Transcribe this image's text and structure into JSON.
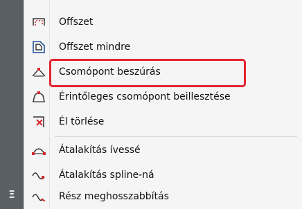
{
  "menu": {
    "items": [
      {
        "label": "Offszet",
        "icon": "offset-icon"
      },
      {
        "label": "Offszet mindre",
        "icon": "offset-all-icon"
      },
      {
        "label": "Csomópont beszúrás",
        "icon": "insert-node-icon"
      },
      {
        "label": "Érintőleges csomópont beillesztése",
        "icon": "tangent-node-icon"
      },
      {
        "label": "Él törlése",
        "icon": "delete-edge-icon"
      },
      {
        "label": "Átalakítás ívessé",
        "icon": "convert-arc-icon"
      },
      {
        "label": "Átalakítás spline-ná",
        "icon": "convert-spline-icon"
      },
      {
        "label": "Rész meghosszabbítás",
        "icon": "extend-segment-icon"
      }
    ]
  },
  "highlighted_item": "Csomópont beszúrás",
  "colors": {
    "highlight_border": "#e5232f",
    "icon_red": "#d8262e",
    "sidebar": "#5a5f64"
  }
}
